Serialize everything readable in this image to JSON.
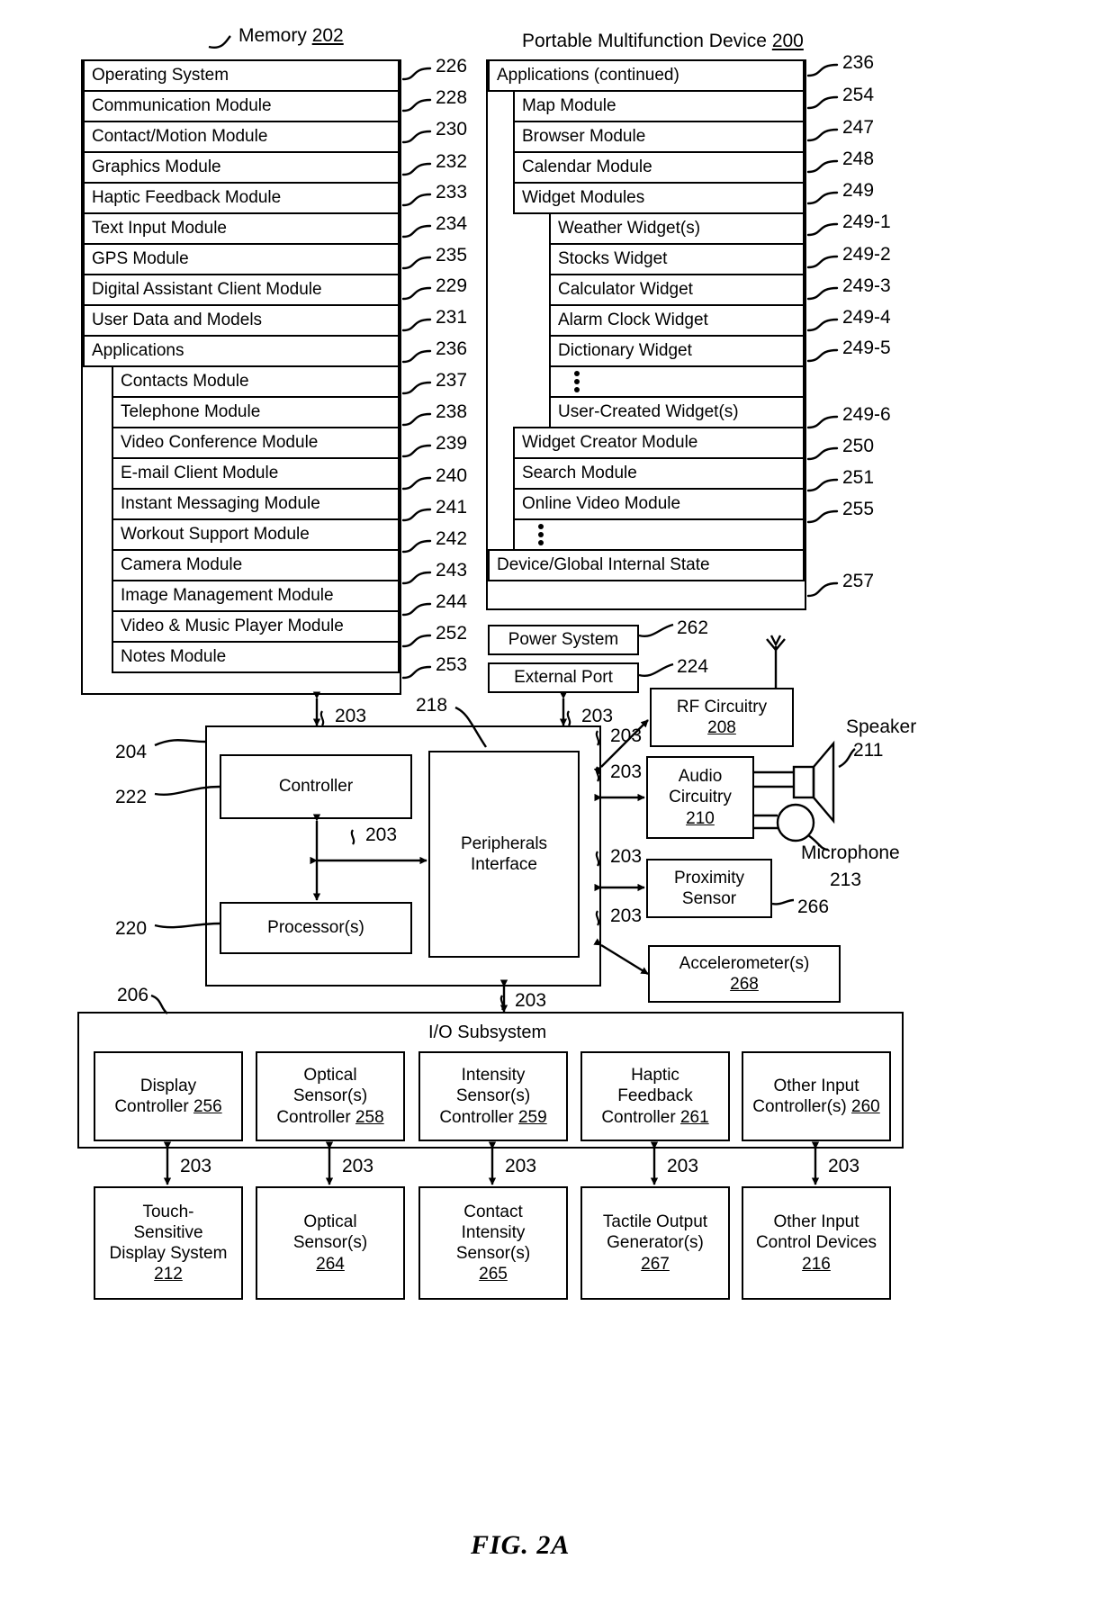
{
  "figure": {
    "caption": "FIG. 2A",
    "memory_title": "Memory",
    "memory_ref": "202",
    "device_title": "Portable Multifunction Device",
    "device_ref": "200"
  },
  "memory_column": {
    "rows": [
      {
        "label": "Operating System",
        "ref": "226"
      },
      {
        "label": "Communication Module",
        "ref": "228"
      },
      {
        "label": "Contact/Motion Module",
        "ref": "230"
      },
      {
        "label": "Graphics Module",
        "ref": "232"
      },
      {
        "label": "Haptic Feedback Module",
        "ref": "233"
      },
      {
        "label": "Text Input Module",
        "ref": "234"
      },
      {
        "label": "GPS Module",
        "ref": "235"
      },
      {
        "label": "Digital Assistant Client Module",
        "ref": "229"
      },
      {
        "label": "User Data and Models",
        "ref": "231"
      },
      {
        "label": "Applications",
        "ref": "236"
      }
    ],
    "applications": [
      {
        "label": "Contacts Module",
        "ref": "237"
      },
      {
        "label": "Telephone Module",
        "ref": "238"
      },
      {
        "label": "Video Conference Module",
        "ref": "239"
      },
      {
        "label": "E-mail Client Module",
        "ref": "240"
      },
      {
        "label": "Instant Messaging Module",
        "ref": "241"
      },
      {
        "label": "Workout Support Module",
        "ref": "242"
      },
      {
        "label": "Camera Module",
        "ref": "243"
      },
      {
        "label": "Image Management Module",
        "ref": "244"
      },
      {
        "label": "Video & Music Player Module",
        "ref": "252"
      },
      {
        "label": "Notes Module",
        "ref": "253"
      }
    ]
  },
  "device_column": {
    "header": {
      "label": "Applications (continued)",
      "ref": "236"
    },
    "apps": [
      {
        "label": "Map Module",
        "ref": "254"
      },
      {
        "label": "Browser Module",
        "ref": "247"
      },
      {
        "label": "Calendar Module",
        "ref": "248"
      },
      {
        "label": "Widget Modules",
        "ref": "249"
      }
    ],
    "widgets": [
      {
        "label": "Weather Widget(s)",
        "ref": "249-1"
      },
      {
        "label": "Stocks Widget",
        "ref": "249-2"
      },
      {
        "label": "Calculator Widget",
        "ref": "249-3"
      },
      {
        "label": "Alarm Clock Widget",
        "ref": "249-4"
      },
      {
        "label": "Dictionary Widget",
        "ref": "249-5"
      },
      {
        "label": "",
        "ref": ""
      },
      {
        "label": "User-Created Widget(s)",
        "ref": "249-6"
      }
    ],
    "apps_tail": [
      {
        "label": "Widget Creator Module",
        "ref": "250"
      },
      {
        "label": "Search Module",
        "ref": "251"
      },
      {
        "label": "Online Video Module",
        "ref": "255"
      }
    ],
    "state": {
      "label": "Device/Global Internal State",
      "ref": "257"
    }
  },
  "power": [
    {
      "label": "Power System",
      "ref": "262"
    },
    {
      "label": "External Port",
      "ref": "224"
    }
  ],
  "core": {
    "cpu_group_ref": "204",
    "controller": {
      "label": "Controller",
      "ref": "222"
    },
    "processor": {
      "label": "Processor(s)",
      "ref": "220"
    },
    "peripherals": {
      "line1": "Peripherals",
      "line2": "Interface",
      "ref": "218"
    },
    "bus_ref": "203"
  },
  "peripherals_right": [
    {
      "line1": "RF Circuitry",
      "line2": "",
      "num": "208",
      "ref": ""
    },
    {
      "line1": "Audio",
      "line2": "Circuitry",
      "num": "210",
      "ref": ""
    },
    {
      "line1": "Proximity",
      "line2": "Sensor",
      "num": "",
      "ref": "266"
    },
    {
      "line1": "Accelerometer(s)",
      "line2": "",
      "num": "268",
      "ref": ""
    }
  ],
  "transducers": {
    "speaker": {
      "label": "Speaker",
      "ref": "211"
    },
    "microphone": {
      "label": "Microphone",
      "ref": "213"
    }
  },
  "io_subsystem": {
    "title": "I/O Subsystem",
    "ref": "206",
    "controllers": [
      {
        "lines": [
          "Display",
          "Controller"
        ],
        "num": "256"
      },
      {
        "lines": [
          "Optical",
          "Sensor(s)",
          "Controller"
        ],
        "num": "258"
      },
      {
        "lines": [
          "Intensity",
          "Sensor(s)",
          "Controller"
        ],
        "num": "259"
      },
      {
        "lines": [
          "Haptic",
          "Feedback",
          "Controller"
        ],
        "num": "261"
      },
      {
        "lines": [
          "Other Input",
          "Controller(s)"
        ],
        "num": "260"
      }
    ],
    "devices": [
      {
        "lines": [
          "Touch-",
          "Sensitive",
          "Display System"
        ],
        "num": "212"
      },
      {
        "lines": [
          "Optical",
          "Sensor(s)"
        ],
        "num": "264"
      },
      {
        "lines": [
          "Contact",
          "Intensity",
          "Sensor(s)"
        ],
        "num": "265"
      },
      {
        "lines": [
          "Tactile Output",
          "Generator(s)"
        ],
        "num": "267"
      },
      {
        "lines": [
          "Other Input",
          "Control Devices"
        ],
        "num": "216"
      }
    ],
    "bus_ref": "203"
  }
}
